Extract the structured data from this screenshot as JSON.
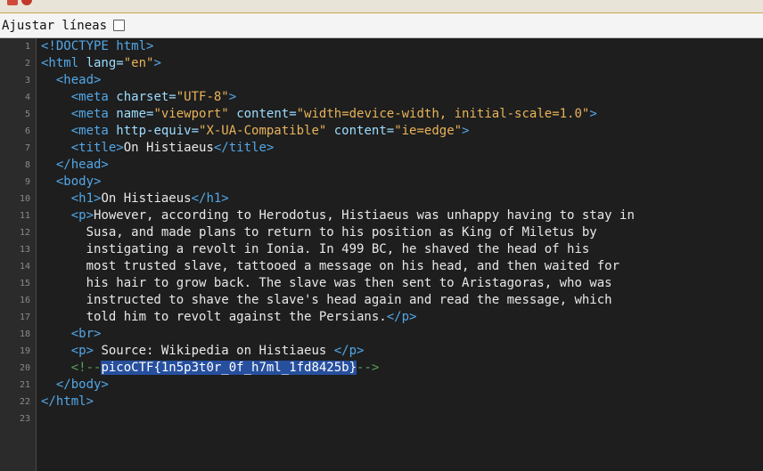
{
  "toolbar": {
    "wrap_label": "Ajustar líneas",
    "wrap_checked": false
  },
  "editor": {
    "lines": [
      {
        "n": "1",
        "parts": [
          {
            "t": "tag",
            "v": "<!DOCTYPE html>"
          }
        ]
      },
      {
        "n": "2",
        "parts": [
          {
            "t": "tag",
            "v": "<html "
          },
          {
            "t": "attr",
            "v": "lang="
          },
          {
            "t": "val",
            "v": "\"en\""
          },
          {
            "t": "tag",
            "v": ">"
          }
        ]
      },
      {
        "n": "3",
        "parts": [
          {
            "t": "tag",
            "v": "  <head>"
          }
        ]
      },
      {
        "n": "4",
        "parts": [
          {
            "t": "tag",
            "v": "    <meta "
          },
          {
            "t": "attr",
            "v": "charset="
          },
          {
            "t": "val",
            "v": "\"UTF-8\""
          },
          {
            "t": "tag",
            "v": ">"
          }
        ]
      },
      {
        "n": "5",
        "parts": [
          {
            "t": "tag",
            "v": "    <meta "
          },
          {
            "t": "attr",
            "v": "name="
          },
          {
            "t": "val",
            "v": "\"viewport\""
          },
          {
            "t": "text",
            "v": " "
          },
          {
            "t": "attr",
            "v": "content="
          },
          {
            "t": "val",
            "v": "\"width=device-width, initial-scale=1.0\""
          },
          {
            "t": "tag",
            "v": ">"
          }
        ]
      },
      {
        "n": "6",
        "parts": [
          {
            "t": "tag",
            "v": "    <meta "
          },
          {
            "t": "attr",
            "v": "http-equiv="
          },
          {
            "t": "val",
            "v": "\"X-UA-Compatible\""
          },
          {
            "t": "text",
            "v": " "
          },
          {
            "t": "attr",
            "v": "content="
          },
          {
            "t": "val",
            "v": "\"ie=edge\""
          },
          {
            "t": "tag",
            "v": ">"
          }
        ]
      },
      {
        "n": "7",
        "parts": [
          {
            "t": "tag",
            "v": "    <title>"
          },
          {
            "t": "text",
            "v": "On Histiaeus"
          },
          {
            "t": "tag",
            "v": "</title>"
          }
        ]
      },
      {
        "n": "8",
        "parts": [
          {
            "t": "tag",
            "v": "  </head>"
          }
        ]
      },
      {
        "n": "9",
        "parts": [
          {
            "t": "tag",
            "v": "  <body>"
          }
        ]
      },
      {
        "n": "10",
        "parts": [
          {
            "t": "tag",
            "v": "    <h1>"
          },
          {
            "t": "text",
            "v": "On Histiaeus"
          },
          {
            "t": "tag",
            "v": "</h1>"
          }
        ]
      },
      {
        "n": "11",
        "parts": [
          {
            "t": "tag",
            "v": "    <p>"
          },
          {
            "t": "text",
            "v": "However, according to Herodotus, Histiaeus was unhappy having to stay in"
          }
        ]
      },
      {
        "n": "12",
        "parts": [
          {
            "t": "text",
            "v": "      Susa, and made plans to return to his position as King of Miletus by"
          }
        ]
      },
      {
        "n": "13",
        "parts": [
          {
            "t": "text",
            "v": "      instigating a revolt in Ionia. In 499 BC, he shaved the head of his"
          }
        ]
      },
      {
        "n": "14",
        "parts": [
          {
            "t": "text",
            "v": "      most trusted slave, tattooed a message on his head, and then waited for"
          }
        ]
      },
      {
        "n": "15",
        "parts": [
          {
            "t": "text",
            "v": "      his hair to grow back. The slave was then sent to Aristagoras, who was"
          }
        ]
      },
      {
        "n": "16",
        "parts": [
          {
            "t": "text",
            "v": "      instructed to shave the slave's head again and read the message, which"
          }
        ]
      },
      {
        "n": "17",
        "parts": [
          {
            "t": "text",
            "v": "      told him to revolt against the Persians."
          },
          {
            "t": "tag",
            "v": "</p>"
          }
        ]
      },
      {
        "n": "18",
        "parts": [
          {
            "t": "tag",
            "v": "    <br>"
          }
        ]
      },
      {
        "n": "19",
        "parts": [
          {
            "t": "tag",
            "v": "    <p>"
          },
          {
            "t": "text",
            "v": " Source: Wikipedia on Histiaeus "
          },
          {
            "t": "tag",
            "v": "</p>"
          }
        ]
      },
      {
        "n": "20",
        "parts": [
          {
            "t": "cmt",
            "v": "    <!--"
          },
          {
            "t": "sel",
            "v": "picoCTF{1n5p3t0r_0f_h7ml_1fd8425b}"
          },
          {
            "t": "cmt",
            "v": "-->"
          }
        ]
      },
      {
        "n": "21",
        "parts": [
          {
            "t": "tag",
            "v": "  </body>"
          }
        ]
      },
      {
        "n": "22",
        "parts": [
          {
            "t": "tag",
            "v": "</html>"
          }
        ]
      },
      {
        "n": "23",
        "parts": []
      }
    ]
  }
}
